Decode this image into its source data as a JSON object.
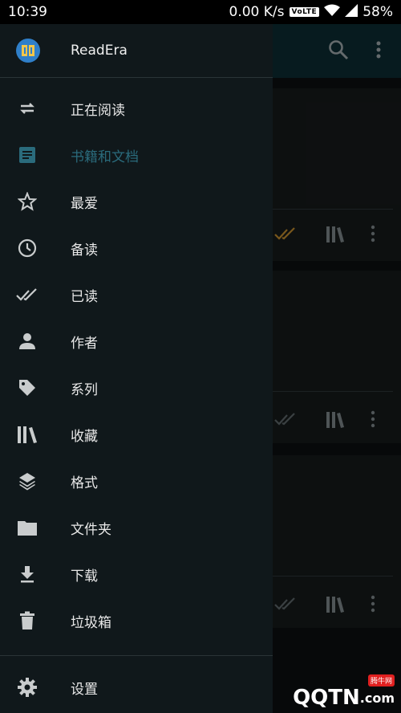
{
  "status_bar": {
    "time": "10:39",
    "net_speed": "0.00 K/s",
    "volte": "VoLTE",
    "battery": "58%"
  },
  "drawer": {
    "app_name": "ReadEra",
    "items": [
      {
        "label": "正在阅读",
        "icon": "repeat-icon"
      },
      {
        "label": "书籍和文档",
        "icon": "document-icon",
        "active": true
      },
      {
        "label": "最爱",
        "icon": "star-icon"
      },
      {
        "label": "备读",
        "icon": "clock-icon"
      },
      {
        "label": "已读",
        "icon": "double-check-icon"
      },
      {
        "label": "作者",
        "icon": "person-icon"
      },
      {
        "label": "系列",
        "icon": "tag-icon"
      },
      {
        "label": "收藏",
        "icon": "library-icon"
      },
      {
        "label": "格式",
        "icon": "layers-icon"
      },
      {
        "label": "文件夹",
        "icon": "folder-icon"
      },
      {
        "label": "下载",
        "icon": "download-icon"
      },
      {
        "label": "垃圾箱",
        "icon": "trash-icon"
      }
    ],
    "settings_label": "设置"
  },
  "colors": {
    "drawer_bg": "#10181b",
    "toolbar_bg": "#0b2a30",
    "active_text": "#2a6b7c",
    "read_check_highlight": "#b8862b"
  },
  "watermark": {
    "text": "QQTN",
    "suffix": ".com",
    "badge": "腾牛网"
  }
}
